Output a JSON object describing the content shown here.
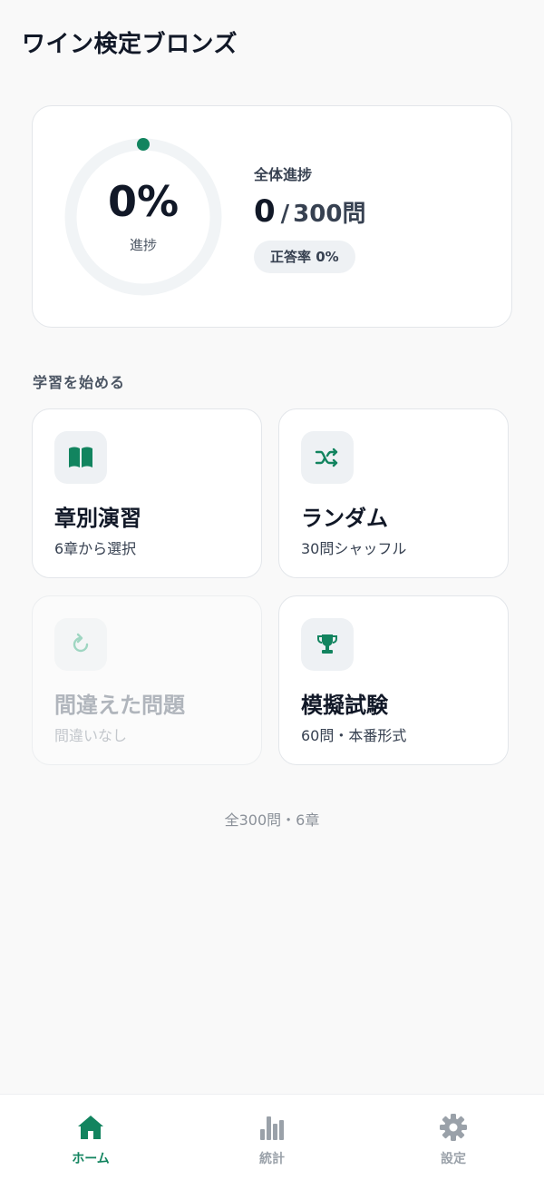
{
  "app": {
    "title": "ワイン検定ブロンズ"
  },
  "progress": {
    "percent_text": "0%",
    "percent_value": 0,
    "ring_label": "進捗",
    "overall_label": "全体進捗",
    "done": "0",
    "slash": "/",
    "total": "300問",
    "accuracy_label": "正答率 0%"
  },
  "section": {
    "title": "学習を始める"
  },
  "modes": [
    {
      "title": "章別演習",
      "subtitle": "6章から選択",
      "icon": "book-icon",
      "enabled": true
    },
    {
      "title": "ランダム",
      "subtitle": "30問シャッフル",
      "icon": "shuffle-icon",
      "enabled": true
    },
    {
      "title": "間違えた問題",
      "subtitle": "間違いなし",
      "icon": "refresh-icon",
      "enabled": false
    },
    {
      "title": "模擬試験",
      "subtitle": "60問・本番形式",
      "icon": "trophy-icon",
      "enabled": true
    }
  ],
  "footer": {
    "note": "全300問・6章"
  },
  "tabs": [
    {
      "label": "ホーム",
      "icon": "home-icon",
      "active": true
    },
    {
      "label": "統計",
      "icon": "bar-chart-icon",
      "active": false
    },
    {
      "label": "設定",
      "icon": "gear-icon",
      "active": false
    }
  ],
  "colors": {
    "accent": "#12845f",
    "ring_track": "#f1f4f6",
    "inactive": "#9aa1a9"
  }
}
